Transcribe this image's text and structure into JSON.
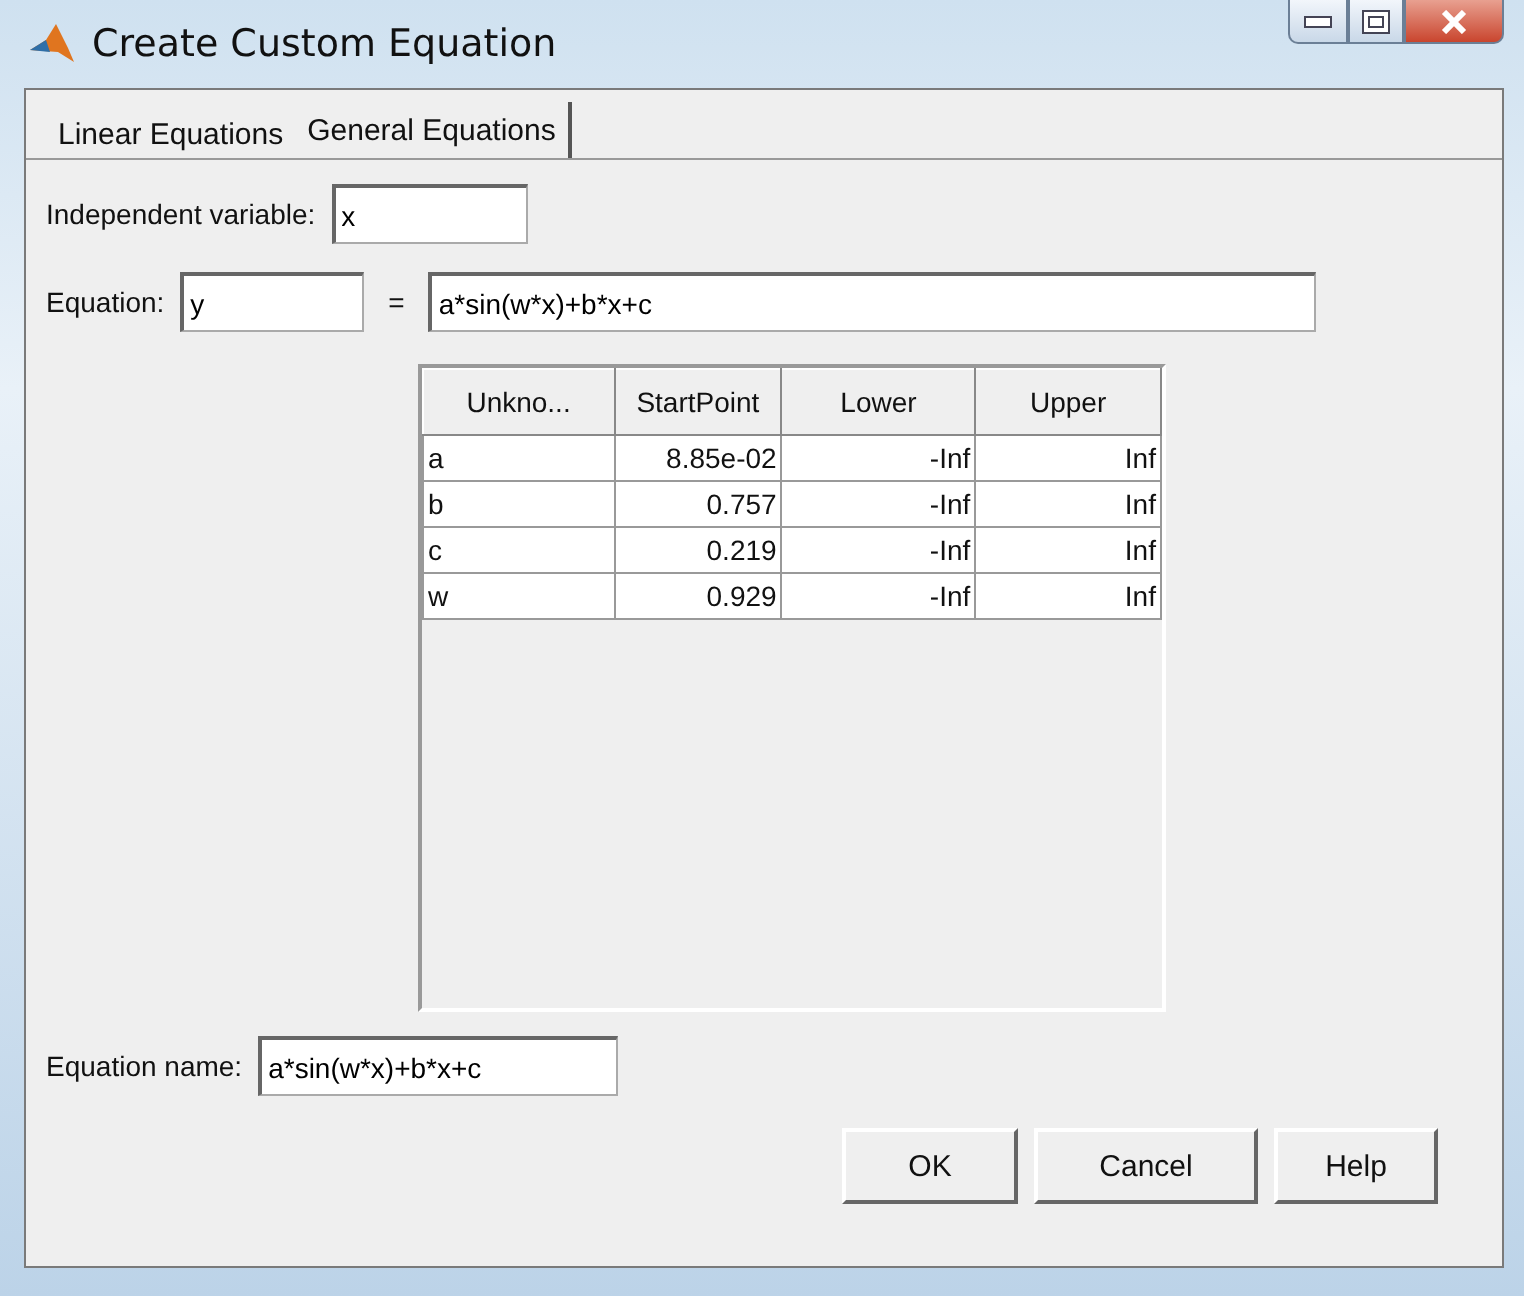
{
  "window": {
    "title": "Create Custom Equation"
  },
  "tabs": [
    {
      "label": "Linear Equations",
      "selected": false
    },
    {
      "label": "General Equations",
      "selected": true
    }
  ],
  "independent_variable": {
    "label": "Independent variable:",
    "value": "x"
  },
  "equation": {
    "label": "Equation:",
    "lhs": "y",
    "equals": "=",
    "rhs": "a*sin(w*x)+b*x+c"
  },
  "table": {
    "columns": [
      "Unkno...",
      "StartPoint",
      "Lower",
      "Upper"
    ],
    "rows": [
      [
        "a",
        "8.85e-02",
        "-Inf",
        "Inf"
      ],
      [
        "b",
        "0.757",
        "-Inf",
        "Inf"
      ],
      [
        "c",
        "0.219",
        "-Inf",
        "Inf"
      ],
      [
        "w",
        "0.929",
        "-Inf",
        "Inf"
      ]
    ]
  },
  "equation_name": {
    "label": "Equation name:",
    "value": "a*sin(w*x)+b*x+c"
  },
  "buttons": [
    "OK",
    "Cancel",
    "Help"
  ]
}
